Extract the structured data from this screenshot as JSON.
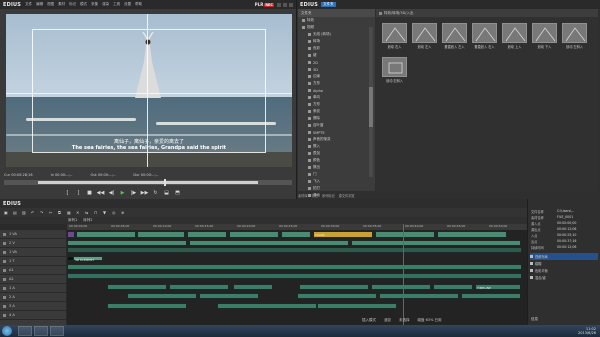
{
  "player": {
    "brand": "EDIUS",
    "menu": [
      "文件",
      "编辑",
      "视图",
      "素材",
      "标记",
      "模式",
      "采集",
      "渲染",
      "工具",
      "设置",
      "帮助"
    ],
    "mode_label": "PLR",
    "rec_label": "REC",
    "subtitle_cn": "离仙子，离仙子，亲爱的离去了",
    "subtitle_en": "The sea fairies, the sea fairies, Grandpa said the spirit",
    "timecodes": [
      "Cur 00:00:28;16",
      "In 00:00:--;--",
      "Out 00:00:--;--",
      "Dur 00:00:--;--"
    ]
  },
  "library": {
    "brand": "EDIUS",
    "tab": "文件夹",
    "content_header": "特效/转场/3D/入出",
    "tree_header": "文件夹",
    "tree": [
      "特效",
      "视频",
      "无线 (转场)",
      "转场",
      "色彩",
      "键",
      "2D",
      "3D",
      "边缘",
      "方形",
      "Alpha",
      "单向",
      "方形",
      "条纹",
      "擦除",
      "百叶窗",
      "SMPTE",
      "声音的渐变",
      "擦入",
      "叠加",
      "颜色",
      "擦出",
      "门",
      "飞入",
      "拍打",
      "滑动",
      "3BIT2",
      "字幕混合",
      "音频",
      "滑动入/出",
      "划入/划出"
    ],
    "effects": [
      "划动 右入",
      "划动 左入",
      "垂直划入 左入",
      "垂直划入 右入",
      "划动 上入",
      "划动 下入",
      "划动 左斜入",
      "划动 右斜入"
    ],
    "tabs": [
      "素材库",
      "特效",
      "序列标记",
      "源文件浏览"
    ]
  },
  "timeline": {
    "brand": "EDIUS",
    "seq_tabs": [
      "序列1",
      "序列2"
    ],
    "ruler": [
      "00:00:00;00",
      "00:00:05;00",
      "00:00:10;00",
      "00:00:15;00",
      "00:00:20;00",
      "00:00:25;00",
      "00:00:30;00",
      "00:00:35;00",
      "00:00:40;00",
      "00:00:45;00",
      "00:00:50;00"
    ],
    "tracks": [
      "1 VA",
      "2 V",
      "1 VA",
      "1 T",
      "A1",
      "A2",
      "1 A",
      "2 A",
      "3 A",
      "4 A"
    ],
    "clips_t": [
      "3D ELEMENT",
      "TIMELINE"
    ],
    "clips_text": "00008"
  },
  "info": {
    "rows": [
      {
        "k": "文件名称",
        "v": "C:\\Users\\..."
      },
      {
        "k": "素材名称",
        "v": "FILE_0001"
      },
      {
        "k": "源入点",
        "v": "00:00:00;00"
      },
      {
        "k": "源出点",
        "v": "00:00:12;06"
      },
      {
        "k": "入点",
        "v": "00:00:25;10"
      },
      {
        "k": "出点",
        "v": "00:00:37;16"
      },
      {
        "k": "持续时间",
        "v": "00:00:12;06"
      }
    ],
    "list": [
      "视频布局",
      "模糊",
      "色彩平衡",
      "混合/键"
    ],
    "bottom": "信息"
  },
  "status": [
    "插入模式",
    "波纹",
    "未选择",
    "磁盘 63% 已用"
  ],
  "tray": {
    "time": "11:02",
    "date": "2013/6/26"
  },
  "colors": {
    "play": "#5ec05e",
    "rec": "#c62828",
    "lib_accent": "#2f6fb5",
    "clip": "#4b8a73",
    "playhead": "#dd3333"
  }
}
